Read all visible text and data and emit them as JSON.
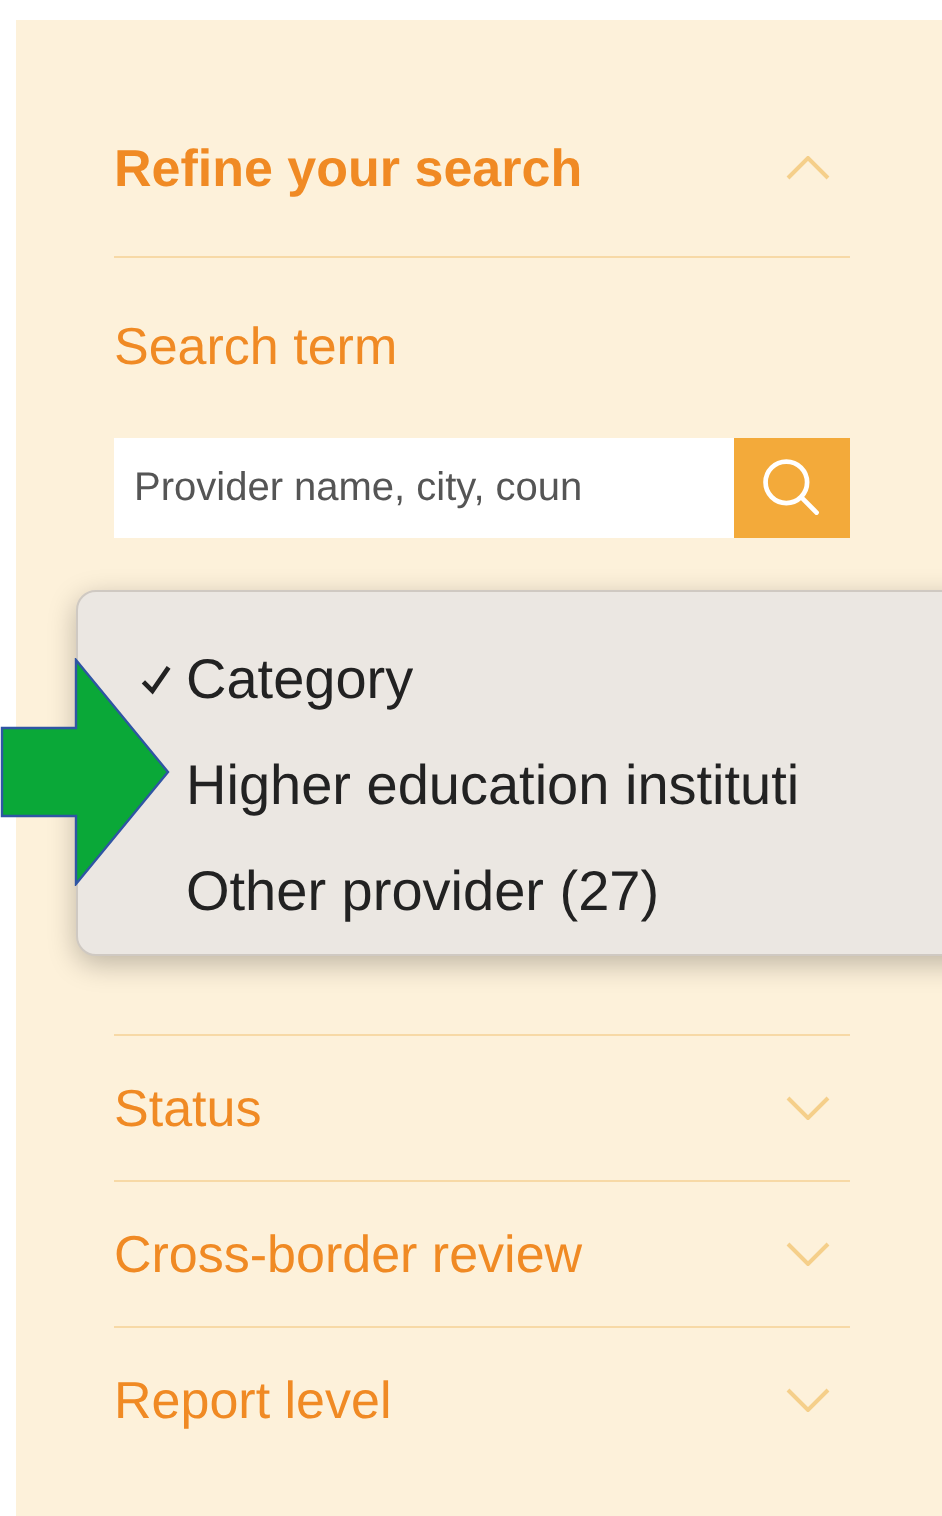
{
  "panel": {
    "title": "Refine your search",
    "expanded": true
  },
  "search": {
    "label": "Search term",
    "placeholder": "Provider name, city, coun"
  },
  "filters": [
    {
      "label": "Status",
      "expanded": false
    },
    {
      "label": "Cross-border review",
      "expanded": false
    },
    {
      "label": "Report level",
      "expanded": false
    }
  ],
  "dropdown_menu": {
    "items": [
      {
        "label": "Category",
        "checked": true
      },
      {
        "label": "Higher education instituti",
        "checked": false
      },
      {
        "label": "Other provider (27)",
        "checked": false
      }
    ]
  }
}
